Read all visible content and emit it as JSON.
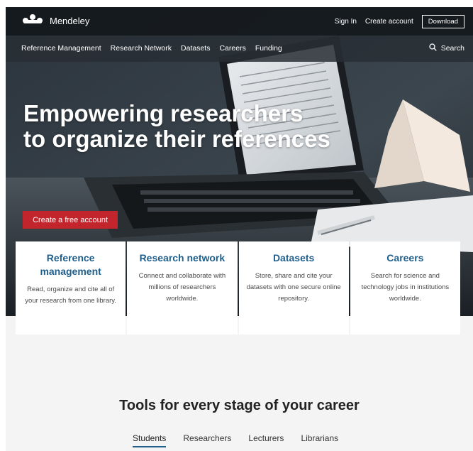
{
  "header": {
    "logo_text": "Mendeley",
    "sign_in": "Sign In",
    "create_account": "Create account",
    "download": "Download"
  },
  "nav": {
    "items": [
      {
        "label": "Reference Management"
      },
      {
        "label": "Research Network"
      },
      {
        "label": "Datasets"
      },
      {
        "label": "Careers"
      },
      {
        "label": "Funding"
      }
    ],
    "search_label": "Search"
  },
  "hero": {
    "headline_line1": "Empowering researchers",
    "headline_line2": "to organize their references",
    "cta": "Create a free account"
  },
  "cards": [
    {
      "title": "Reference management",
      "desc": "Read, organize and cite all of your research from one library."
    },
    {
      "title": "Research network",
      "desc": "Connect and collaborate with millions of researchers worldwide."
    },
    {
      "title": "Datasets",
      "desc": "Store, share and cite your datasets with one secure online repository."
    },
    {
      "title": "Careers",
      "desc": "Search for science and technology jobs in institutions worldwide."
    }
  ],
  "tools": {
    "title": "Tools for every stage of your career",
    "tabs": [
      {
        "label": "Students",
        "active": true
      },
      {
        "label": "Researchers"
      },
      {
        "label": "Lecturers"
      },
      {
        "label": "Librarians"
      }
    ]
  },
  "colors": {
    "accent": "#c3252c",
    "link": "#1f5f8c",
    "topbar": "#14181c"
  },
  "icons": {
    "logo": "mendeley-logo-icon",
    "search": "search-icon"
  }
}
